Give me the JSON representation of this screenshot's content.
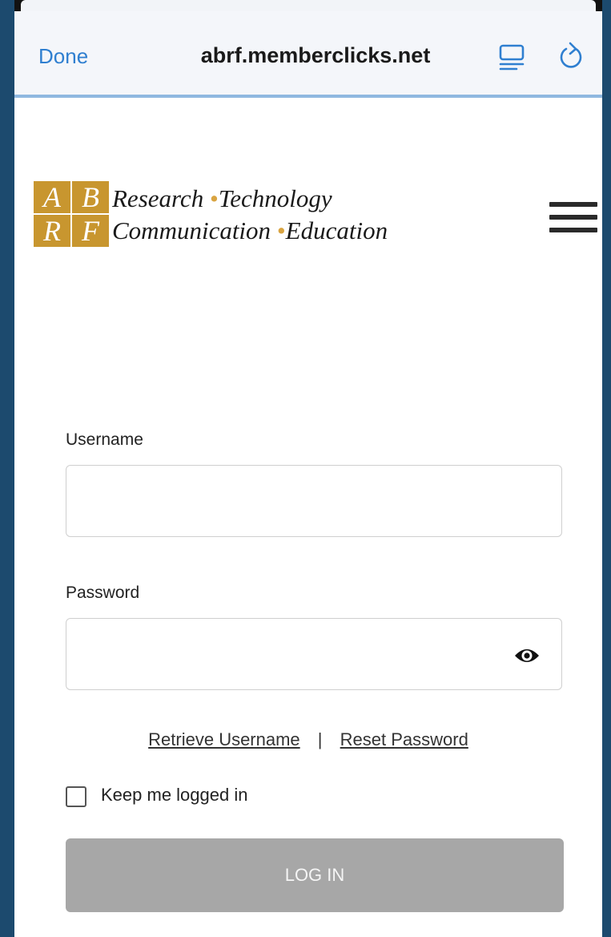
{
  "browser": {
    "done_label": "Done",
    "url": "abrf.memberclicks.net",
    "reader_icon": "reader-mode-icon",
    "reload_icon": "reload-icon"
  },
  "logo": {
    "letters": [
      "A",
      "B",
      "R",
      "F"
    ],
    "line1_a": "Research",
    "line1_b": "Technology",
    "line2_a": "Communication",
    "line2_b": "Education",
    "separator": "•"
  },
  "menu_icon": "hamburger-menu-icon",
  "form": {
    "username_label": "Username",
    "username_value": "",
    "password_label": "Password",
    "password_value": "",
    "show_password_icon": "eye-icon",
    "retrieve_username": "Retrieve Username",
    "link_separator": "|",
    "reset_password": "Reset Password",
    "keep_logged_in_label": "Keep me logged in",
    "keep_logged_in_checked": false,
    "login_button": "LOG IN"
  },
  "colors": {
    "link_blue": "#2f7fd0",
    "logo_gold": "#c8962f",
    "button_disabled": "#a7a7a7"
  }
}
